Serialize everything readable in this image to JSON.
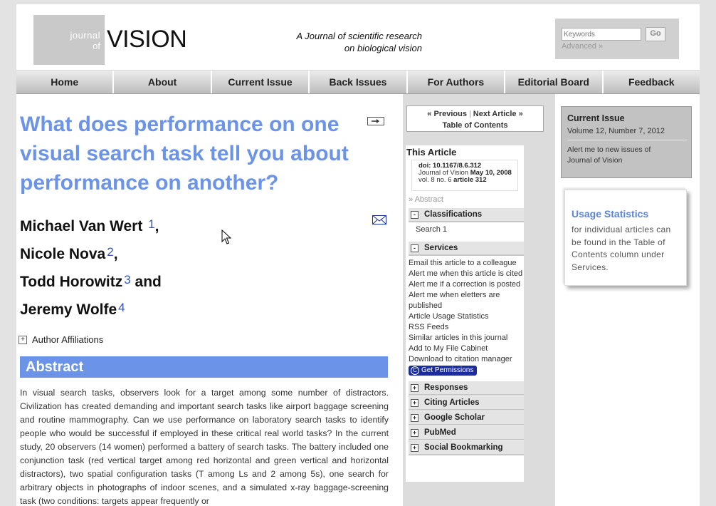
{
  "header": {
    "logo_journal": "journal",
    "logo_of": "of",
    "logo_vision": "VISION",
    "tagline_line1": "A Journal of scientific research",
    "tagline_line2": "on biological vision",
    "search_placeholder": "Keywords",
    "go_label": "Go",
    "advanced_label": "Advanced »"
  },
  "nav": {
    "items": [
      "Home",
      "About",
      "Current Issue",
      "Back Issues",
      "For Authors",
      "Editorial Board",
      "Feedback"
    ]
  },
  "article": {
    "title": "What does performance on one visual search task tell you about performance on another?",
    "authors": [
      {
        "name": "Michael Van Wert",
        "sup": "1",
        "suffix": ","
      },
      {
        "name": "Nicole Nova",
        "sup": "2",
        "suffix": ","
      },
      {
        "name": "Todd Horowitz",
        "sup": "3",
        "suffix": " and"
      },
      {
        "name": "Jeremy Wolfe",
        "sup": "4",
        "suffix": ""
      }
    ],
    "affiliations_label": "Author Affiliations",
    "abstract_heading": "Abstract",
    "abstract_text": "In visual search tasks, observers look for a target among some number of distractors. Civilization has created demanding and important search tasks like airport baggage screening and routine mammography. Can we use performance on laboratory search tasks to identify people who would be successful if employed in these critical real world tasks? In the current study, 20 observers (14 women) performed a battery of search tasks. The battery included one conjunction task (red vertical target among red horizontal and green vertical and horizontal distractors), two spatial configuration tasks (T among Ls and 2 among 5s), one search for arbitrary objects in photographs of indoor scenes, and a simulated x-ray baggage-screening task (two conditions: targets appear frequently or"
  },
  "sidebar": {
    "prev_label": "« Previous",
    "next_label": "Next Article »",
    "toc_label": "Table of Contents",
    "this_article": "This Article",
    "doi": "doi: 10.1167/8.6.312",
    "journal_line_prefix": "Journal of Vision ",
    "journal_date": "May 10, 2008",
    "vol_line_prefix": "vol. 8 no. 6 ",
    "vol_article": "article 312",
    "abstract_link": "» Abstract",
    "classifications_label": "Classifications",
    "classification_item": "Search 1",
    "services_label": "Services",
    "services": [
      "Email this article to a colleague",
      "Alert me when this article is cited",
      "Alert me if a correction is posted",
      "Alert me when eletters are published",
      "Article Usage Statistics",
      "RSS Feeds",
      "Similar articles in this journal",
      "Add to My File Cabinet",
      "Download to citation manager"
    ],
    "permissions_label": "Get Permissions",
    "collapsed_sections": [
      "Responses",
      "Citing Articles",
      "Google Scholar",
      "PubMed",
      "Social Bookmarking"
    ]
  },
  "right": {
    "current_issue_heading": "Current Issue",
    "current_issue_volume": "Volume 12, Number 7, 2012",
    "alert_text": "Alert me to new issues of Journal of Vision",
    "usage_heading": "Usage Statistics",
    "usage_text": "for individual articles can be found in the Table of Contents column under Services."
  },
  "colors": {
    "accent_blue": "#6b94e8",
    "permissions_blue": "#1b2d9a",
    "sidebar_gray": "#dcdcdc"
  }
}
